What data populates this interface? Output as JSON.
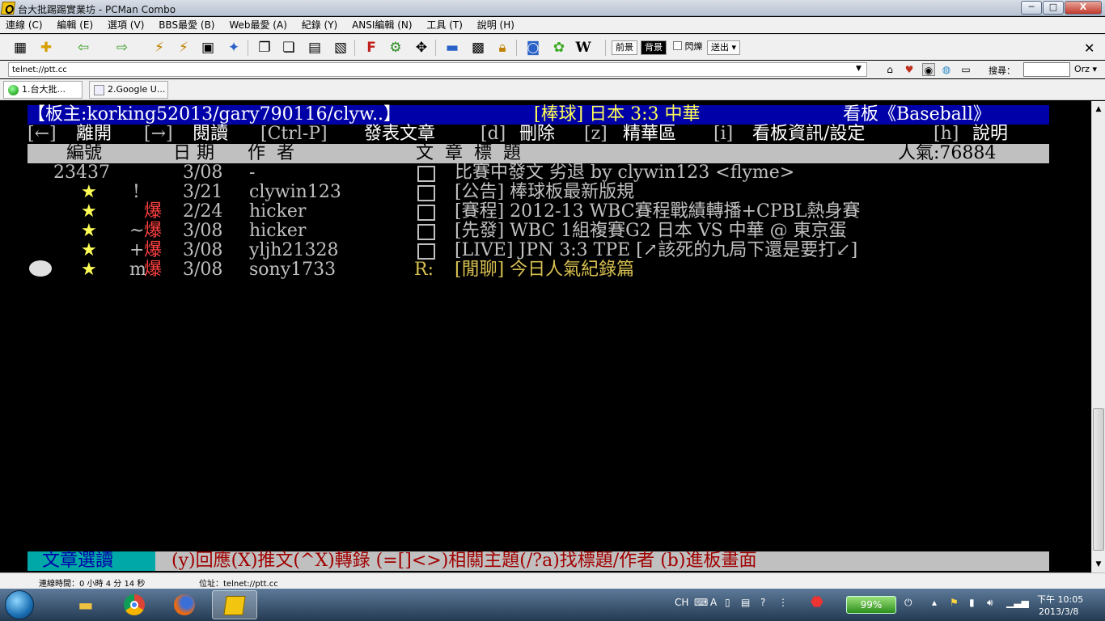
{
  "window": {
    "title": "台大批踢踢實業坊 - PCMan Combo",
    "min_label": "─",
    "max_label": "□",
    "close_label": "X"
  },
  "menu": [
    "連線 (C)",
    "編輯 (E)",
    "選項 (V)",
    "BBS最愛 (B)",
    "Web最愛 (A)",
    "紀錄 (Y)",
    "ANSI編輯 (N)",
    "工具 (T)",
    "說明 (H)"
  ],
  "toolbar": {
    "fg_label": "前景",
    "bg_label": "背景",
    "blink_label": "閃爍",
    "send_label": "送出",
    "wiki_label": "W",
    "font_label": "F"
  },
  "address": {
    "value": "telnet://ptt.cc",
    "search_label": "搜尋：",
    "search_engine": "Orz"
  },
  "tabs": [
    {
      "label": "1.台大批..."
    },
    {
      "label": "2.Google U..."
    }
  ],
  "terminal": {
    "header_left": "【板主:korking52013/gary790116/clyw..】",
    "header_title": "[棒球] 日本 3:3 中華",
    "header_right": "看板《Baseball》",
    "help": {
      "leave_key": "[←]",
      "leave": "離開",
      "read_key": "[→]",
      "read": "閱讀",
      "post_key": "[Ctrl-P]",
      "post": "發表文章",
      "delete_key": "[d]",
      "delete": "刪除",
      "digest_key": "[z]",
      "digest": "精華區",
      "info_key": "[i]",
      "info": "看板資訊/設定",
      "help_key": "[h]",
      "help": "說明"
    },
    "columns": {
      "number": "編號",
      "date": "日 期",
      "author": "作  者",
      "title": "文  章  標  題",
      "popularity": "人氣:76884"
    },
    "posts": [
      {
        "num": "23437",
        "star": "",
        "mark": "",
        "recommend": "",
        "date": "3/08",
        "author": "-",
        "status": "box",
        "title": "比賽中發文 劣退 by clywin123 <flyme>"
      },
      {
        "num": "",
        "star": "★",
        "mark": "!",
        "recommend": "",
        "date": "3/21",
        "author": "clywin123",
        "status": "box",
        "title": "[公告] 棒球板最新版規"
      },
      {
        "num": "",
        "star": "★",
        "mark": "",
        "recommend": "爆",
        "date": "2/24",
        "author": "hicker",
        "status": "box",
        "title": "[賽程] 2012-13 WBC賽程戰績轉播+CPBL熱身賽"
      },
      {
        "num": "",
        "star": "★",
        "mark": "~",
        "recommend": "爆",
        "date": "3/08",
        "author": "hicker",
        "status": "box",
        "title": "[先發] WBC 1組複賽G2 日本 VS 中華 @ 東京蛋"
      },
      {
        "num": "",
        "star": "★",
        "mark": "+",
        "recommend": "爆",
        "date": "3/08",
        "author": "yljh21328",
        "status": "box",
        "title": "[LIVE] JPN 3:3 TPE [↗該死的九局下還是要打↙]"
      },
      {
        "num": "",
        "star": "★",
        "mark": "m",
        "recommend": "爆",
        "date": "3/08",
        "author": "sony1733",
        "status": "R:",
        "title": "[閒聊] 今日人氣紀錄篇"
      }
    ],
    "footer": {
      "tag": "文章選讀",
      "text": "(y)回應(X)推文(^X)轉錄 (=[]<>)相關主題(/?a)找標題/作者 (b)進板畫面"
    }
  },
  "status": {
    "connection": "連線時間：0 小時 4 分 14 秒",
    "address": "位址：telnet://ptt.cc"
  },
  "taskbar": {
    "battery": "99%",
    "lang": "CH",
    "time": "下午 10:05",
    "date": "2013/3/8"
  },
  "colors": {
    "header_bg": "#0000a8",
    "bar_bg": "#c0c0c0",
    "footer_tag_bg": "#00a8a8",
    "recommend": "#ff4040",
    "star": "#ffff55"
  }
}
